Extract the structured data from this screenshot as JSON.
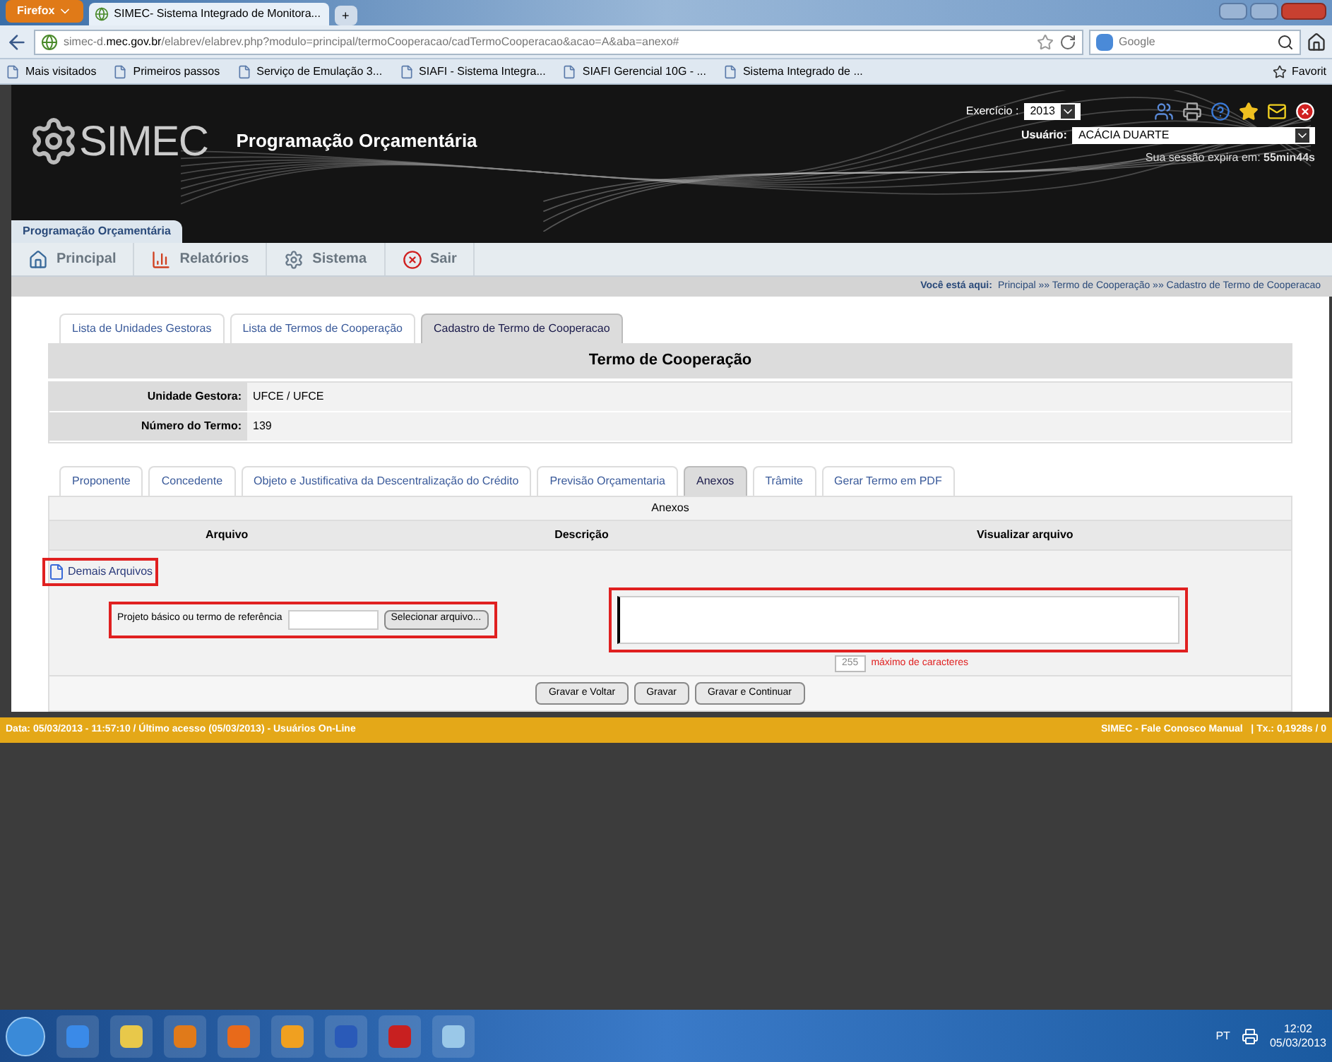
{
  "browser": {
    "menu_button": "Firefox",
    "tabs": [
      {
        "label": "SIMEC- Sistema Integrado de Monitora...",
        "selected": true
      }
    ],
    "new_tab": "+",
    "url_prefix": "simec-d.",
    "url_domain": "mec.gov.br",
    "url_rest": "/elabrev/elabrev.php?modulo=principal/termoCooperacao/cadTermoCooperacao&acao=A&aba=anexo#",
    "search_placeholder": "Google",
    "bookmarks": [
      "Mais visitados",
      "Primeiros passos",
      "Serviço de Emulação 3...",
      "SIAFI - Sistema Integra...",
      "SIAFI Gerencial 10G - ...",
      "Sistema Integrado de ..."
    ],
    "favorites": "Favorit"
  },
  "header": {
    "logo": "SIMEC",
    "title": "Programação Orçamentária",
    "exercicio_label": "Exercício :",
    "exercicio_value": "2013",
    "usuario_label": "Usuário:",
    "usuario_value": "ACÁCIA DUARTE",
    "session_prefix": "Sua sessão expira em: ",
    "session_time": "55min44s",
    "module_tab": "Programação Orçamentária"
  },
  "menu": [
    {
      "label": "Principal",
      "kind": "home"
    },
    {
      "label": "Relatórios",
      "kind": "report"
    },
    {
      "label": "Sistema",
      "kind": "system"
    },
    {
      "label": "Sair",
      "kind": "exit"
    }
  ],
  "breadcrumb": {
    "label": "Você está aqui:",
    "path": "Principal »» Termo de Cooperação »» Cadastro de Termo de Cooperacao"
  },
  "top_tabs": [
    {
      "label": "Lista de Unidades Gestoras",
      "selected": false
    },
    {
      "label": "Lista de Termos de Cooperação",
      "selected": false
    },
    {
      "label": "Cadastro de Termo de Cooperacao",
      "selected": true
    }
  ],
  "form_title": "Termo de Cooperação",
  "fields": [
    {
      "label": "Unidade Gestora:",
      "value": "UFCE / UFCE"
    },
    {
      "label": "Número do Termo:",
      "value": "139"
    }
  ],
  "sub_tabs": [
    {
      "label": "Proponente",
      "selected": false
    },
    {
      "label": "Concedente",
      "selected": false
    },
    {
      "label": "Objeto e Justificativa da Descentralização do Crédito",
      "selected": false
    },
    {
      "label": "Previsão Orçamentaria",
      "selected": false
    },
    {
      "label": "Anexos",
      "selected": true
    },
    {
      "label": "Trâmite",
      "selected": false
    },
    {
      "label": "Gerar Termo em PDF",
      "selected": false
    }
  ],
  "anexos": {
    "title": "Anexos",
    "columns": [
      "Arquivo",
      "Descrição",
      "Visualizar arquivo"
    ],
    "add_link": "Demais Arquivos",
    "file_label": "Projeto básico ou termo de referência",
    "file_button": "Selecionar arquivo...",
    "counter": "255",
    "counter_note": "máximo de caracteres"
  },
  "buttons": [
    "Gravar e Voltar",
    "Gravar",
    "Gravar e Continuar"
  ],
  "status_bar": {
    "left": "Data: 05/03/2013 - 11:57:10 / Último acesso (05/03/2013) - Usuários On-Line",
    "right": "SIMEC - Fale Conosco Manual   | Tx.: 0,1928s / 0"
  },
  "taskbar": {
    "language": "PT",
    "time": "12:02",
    "date": "05/03/2013"
  }
}
